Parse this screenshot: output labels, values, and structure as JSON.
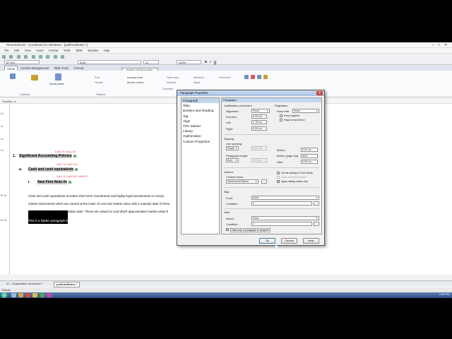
{
  "window": {
    "title": "PersonalACD - Contribute for Windows - [pulfinedNotes *]",
    "controls": [
      "–",
      "□",
      "✕"
    ]
  },
  "menubar": [
    "File",
    "Edit",
    "View",
    "Insert",
    "Format",
    "Tools",
    "Table",
    "Window",
    "Help"
  ],
  "format_toolbar": {
    "style": "M:Text",
    "font": "Arial",
    "size": "11",
    "zoom": "100%",
    "buttons": [
      "B",
      "I",
      "U"
    ]
  },
  "ribbon": {
    "tabs": [
      "Home",
      "Content Management",
      "Table Tools",
      "Format"
    ],
    "active_tab": "Home",
    "tooltip": "Switch On-line Help",
    "groups": {
      "content_label": "Content",
      "shared_label": "Shared",
      "modify_styles": "Modify styles",
      "increase_level": "Increase level",
      "access_level": "Access a level",
      "row": "Row",
      "header": "Header",
      "table_wrap": "Table wrap",
      "subtotal": "Subtotal",
      "calculate": "Calculate",
      "attributes": "Attributes",
      "equal": "Equal",
      "reference": "Reference"
    }
  },
  "breadcrumb": "ParaNbr...e",
  "document": {
    "gutter_tags": [
      "L0",
      "L1",
      "L2",
      "L3",
      "M: Te",
      "M: Te"
    ],
    "items": [
      {
        "ref": "AAA-01 AAA-02",
        "num": "1.",
        "text": "Significant Accounting Policies"
      },
      {
        "ref": "AAC-01 AAC-02",
        "num": "a.",
        "text": "Cash and cash equivalents"
      },
      {
        "ref": "AAC-01 AAC001 AB001",
        "num": "i.",
        "text": "New Firm Note #s"
      }
    ],
    "body_lines": [
      "Cash and cash equivalents includes short-term investments and highly liquid investments in money",
      "market instruments which are carried at the lower of cost and market value with a maturity date of three",
      "months or less from the acquisition date.  These are valued at cost which approximates market value.¶"
    ],
    "hidden_paragraph": "This is a hidden paragraph.¶"
  },
  "doc_tabs": [
    "01 - Organization (Insider)6 *",
    "pulfinedNotes *"
  ],
  "status": "Ready",
  "taskbar": {
    "clock": "1:05 PM"
  },
  "dialog": {
    "title": "Paragraph Properties",
    "close": "✕",
    "categories": [
      "Paragraph",
      "Tabs",
      "Borders and Shading",
      "Tag",
      "Align",
      "TOC Marker",
      "Library",
      "Hyphenation",
      "Custom Properties"
    ],
    "selected_category": "Paragraph",
    "pane_header": "Paragraph",
    "justification": {
      "section": "Justification and Indent",
      "alignment_label": "Alignment:",
      "alignment": "Flush",
      "first_line_label": "First line:",
      "first_line": "0.00 cm",
      "left_label": "Left:",
      "left": "1.78 cm",
      "right_label": "Right:",
      "right": "0.00 cm"
    },
    "pagination": {
      "section": "Pagination",
      "keep_with_label": "Keep with:",
      "keep_with": "None",
      "keep_together": "Keep together",
      "page_break_before": "Page break before"
    },
    "spacing": {
      "section": "Spacing",
      "line_spacing_label": "Line spacing:",
      "line_spacing": "Single",
      "line_spacing_value": "0.00 cm",
      "paragraph_height_label": "Paragraph height:",
      "paragraph_height": "Auto",
      "paragraph_height_value": "0.00 cm",
      "before_label": "Before:",
      "before": "0.51 cm",
      "before_page_top_label": "Before (page top):",
      "before_page_top": "Auto",
      "after_label": "After:",
      "after": "0.00 cm"
    },
    "options": {
      "section": "Options",
      "context_menu_label": "Context menu:",
      "context_menu": "DsfviewsTextMenu",
      "context_menu_btn": "...",
      "permit_editing": "Permit editing in Form Mode",
      "clear_on_roll_forward": "Clear on Roll Forward",
      "apply_styles": "Apply sliding styles only"
    },
    "skip": {
      "section": "Skip",
      "from_label": "From:",
      "from": "None",
      "condition_label": "Condition:",
      "condition": "1",
      "condition_btn": "..."
    },
    "hide": {
      "section": "Hide",
      "action_label": "Action:",
      "action": "None",
      "condition_label": "Condition:",
      "condition": "1",
      "condition_btn": "...",
      "hide_only_if_stripped": "Hide only if paragraph is stripped"
    },
    "buttons": {
      "ok": "Ok",
      "cancel": "Cancel",
      "help": "Help"
    }
  }
}
